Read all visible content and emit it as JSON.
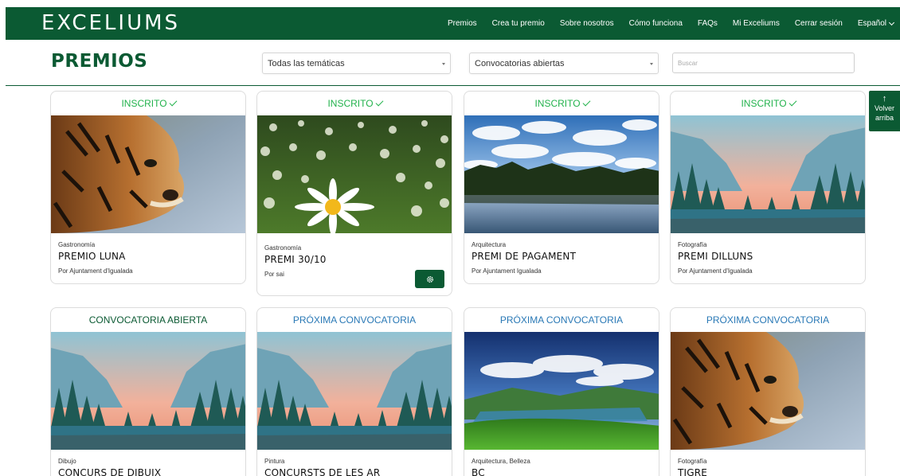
{
  "brand": {
    "logo": "EXCELIUMS",
    "primary": "#0b5a33"
  },
  "nav": [
    {
      "label": "Premios"
    },
    {
      "label": "Crea tu premio"
    },
    {
      "label": "Sobre nosotros"
    },
    {
      "label": "Cómo funciona"
    },
    {
      "label": "FAQs"
    },
    {
      "label": "Mi Exceliums"
    },
    {
      "label": "Cerrar sesión"
    },
    {
      "label": "Español"
    }
  ],
  "page": {
    "title": "PREMIOS"
  },
  "filters": {
    "theme_select": "Todas las temáticas",
    "status_select": "Convocatorias abiertas",
    "search_placeholder": "Buscar"
  },
  "back_to_top": {
    "icon": "arrow-up-icon",
    "line1": "Volver",
    "line2": "arriba"
  },
  "cards": [
    {
      "status": "INSCRITO",
      "status_color": "#22b24c",
      "image": "tiger-photo",
      "category": "Gastronomía",
      "name": "PREMIO LUNA",
      "by": "Por Ajuntament d'Igualada"
    },
    {
      "status": "INSCRITO",
      "status_color": "#22b24c",
      "image": "daisy-photo",
      "category": "Gastronomía",
      "name": "PREMI 30/10",
      "by": "Por sai",
      "action_icon": "gear-icon"
    },
    {
      "status": "INSCRITO",
      "status_color": "#22b24c",
      "image": "lake-clouds-photo",
      "category": "Arquitectura",
      "name": "PREMI DE PAGAMENT",
      "by": "Por Ajuntament Igualada"
    },
    {
      "status": "INSCRITO",
      "status_color": "#22b24c",
      "image": "valley-forest-photo",
      "category": "Fotografía",
      "name": "PREMI DILLUNS",
      "by": "Por Ajuntament d'Igualada"
    },
    {
      "status": "CONVOCATORIA ABIERTA",
      "status_color": "#0b5a33",
      "image": "valley-forest-photo",
      "category": "Dibujo",
      "name": "CONCURS DE DIBUIX"
    },
    {
      "status": "PRÓXIMA CONVOCATORIA",
      "status_color": "#2a79b6",
      "image": "valley-forest-photo",
      "category": "Pintura",
      "name": "CONCURSTS DE LES AR"
    },
    {
      "status": "PRÓXIMA CONVOCATORIA",
      "status_color": "#2a79b6",
      "image": "green-landscape-photo",
      "category": "Arquitectura, Belleza",
      "name": "BC"
    },
    {
      "status": "PRÓXIMA CONVOCATORIA",
      "status_color": "#2a79b6",
      "image": "tiger-photo",
      "category": "Fotografía",
      "name": "TIGRE"
    }
  ]
}
